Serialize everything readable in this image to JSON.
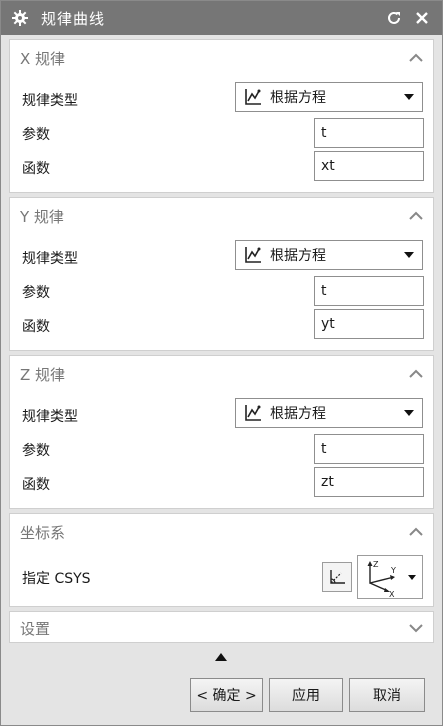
{
  "window": {
    "title": "规律曲线",
    "icons": {
      "app": "gear-icon",
      "reset": "reset-icon",
      "close": "close-icon"
    }
  },
  "sections": {
    "x": {
      "title": "X 规律",
      "law_type_label": "规律类型",
      "law_type_value": "根据方程",
      "param_label": "参数",
      "param_value": "t",
      "func_label": "函数",
      "func_value": "xt"
    },
    "y": {
      "title": "Y 规律",
      "law_type_label": "规律类型",
      "law_type_value": "根据方程",
      "param_label": "参数",
      "param_value": "t",
      "func_label": "函数",
      "func_value": "yt"
    },
    "z": {
      "title": "Z 规律",
      "law_type_label": "规律类型",
      "law_type_value": "根据方程",
      "param_label": "参数",
      "param_value": "t",
      "func_label": "函数",
      "func_value": "zt"
    },
    "csys": {
      "title": "坐标系",
      "specify_label": "指定 CSYS",
      "axis_z": "Z",
      "axis_y": "Y",
      "axis_x": "X"
    },
    "settings": {
      "title": "设置"
    }
  },
  "buttons": {
    "ok": "< 确定 >",
    "apply": "应用",
    "cancel": "取消"
  },
  "colors": {
    "titlebar": "#767676",
    "panel_bg": "#e4e4e4",
    "group_bg": "#ffffff"
  }
}
